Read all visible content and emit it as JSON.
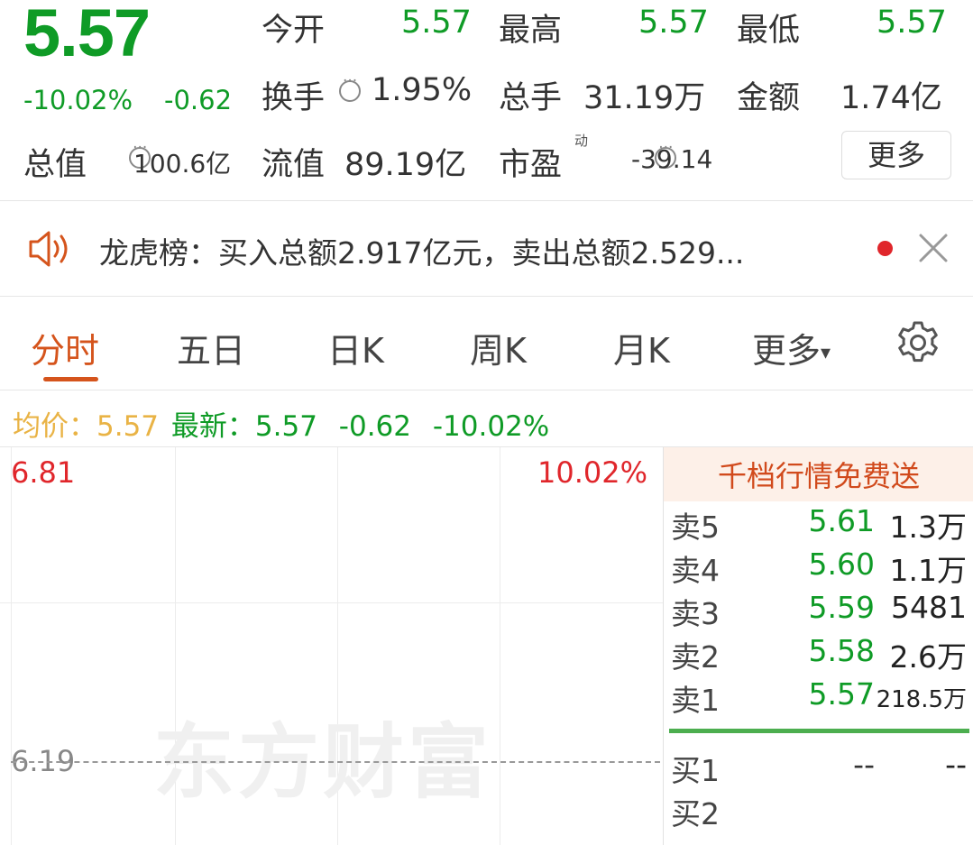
{
  "quote": {
    "price": "5.57",
    "change_pct": "-10.02%",
    "change": "-0.62",
    "stats": [
      {
        "label": "今开",
        "value": "5.57"
      },
      {
        "label": "最高",
        "value": "5.57"
      },
      {
        "label": "最低",
        "value": "5.57"
      },
      {
        "label": "换手",
        "value": "1.95%"
      },
      {
        "label": "总手",
        "value": "31.19万"
      },
      {
        "label": "金额",
        "value": "1.74亿"
      },
      {
        "label": "总值",
        "value": "100.6亿"
      },
      {
        "label": "流值",
        "value": "89.19亿"
      },
      {
        "label": "市盈",
        "superscript": "动",
        "value": "-39.14"
      }
    ],
    "more_label": "更多"
  },
  "notice": {
    "text": "龙虎榜：买入总额2.917亿元，卖出总额2.529...",
    "icons": [
      "speaker-icon",
      "close-icon"
    ]
  },
  "tabs": {
    "items": [
      "分时",
      "五日",
      "日K",
      "周K",
      "月K",
      "更多"
    ],
    "active": "分时",
    "more_arrow": "▾"
  },
  "avg_row": {
    "avg_label": "均价：",
    "avg_value": "5.57",
    "latest_label": "最新：",
    "latest_value": "5.57",
    "latest_change": "-0.62",
    "latest_pct": "-10.02%"
  },
  "chart": {
    "y_top": "6.81",
    "pct_top": "10.02%",
    "y_mid": "6.19",
    "watermark": "东方财富"
  },
  "order_book": {
    "promo": "千档行情免费送",
    "sell": [
      {
        "label": "卖5",
        "price": "5.61",
        "volume": "1.3万"
      },
      {
        "label": "卖4",
        "price": "5.60",
        "volume": "1.1万"
      },
      {
        "label": "卖3",
        "price": "5.59",
        "volume": "5481"
      },
      {
        "label": "卖2",
        "price": "5.58",
        "volume": "2.6万"
      },
      {
        "label": "卖1",
        "price": "5.57",
        "volume": "218.5万"
      }
    ],
    "buy": [
      {
        "label": "买1",
        "price": "--",
        "volume": "--"
      },
      {
        "label": "买2",
        "price": "",
        "volume": ""
      }
    ]
  },
  "colors": {
    "down_green": "#0f9b26",
    "up_red": "#e0262b",
    "active_tab": "#d5541c",
    "avg_yellow": "#e9b345",
    "book_separator": "#4cae4f"
  }
}
